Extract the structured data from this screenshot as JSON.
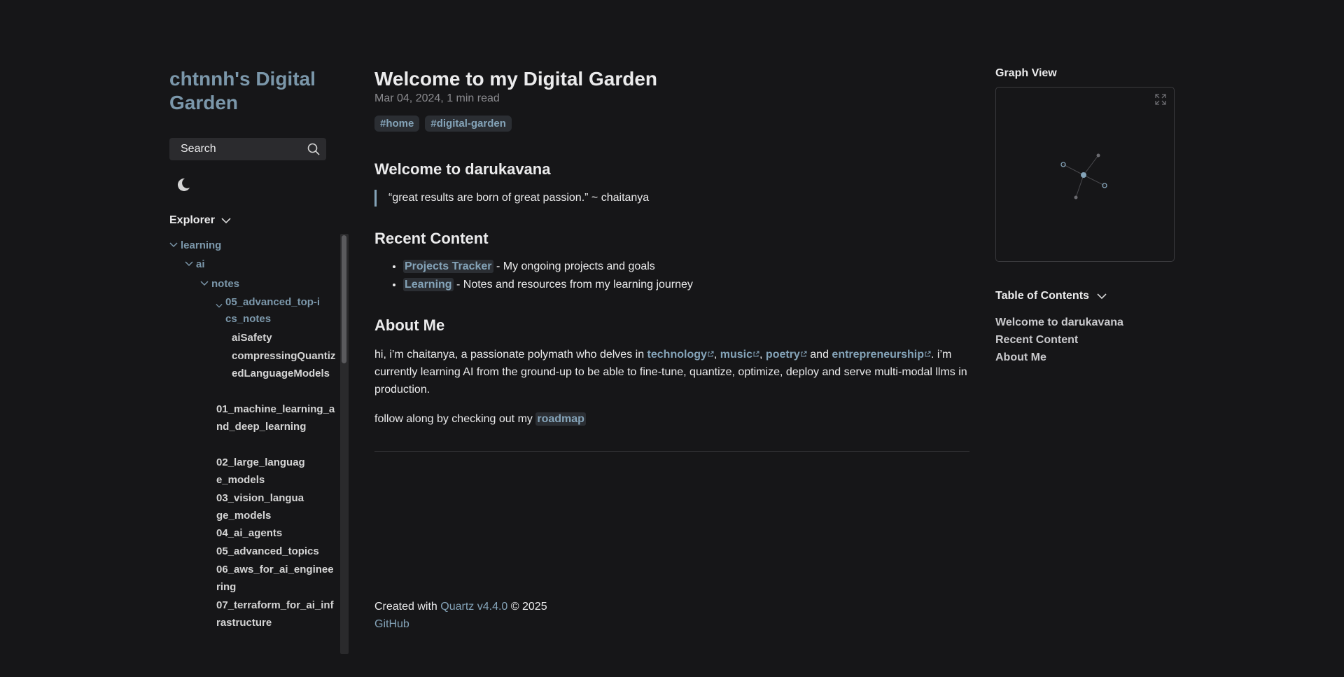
{
  "sidebar": {
    "site_title": "chtnnh's Digital Garden",
    "search_label": "Search",
    "explorer_label": "Explorer",
    "tree": [
      {
        "label": "learning",
        "type": "folder",
        "depth": 0
      },
      {
        "label": "ai",
        "type": "folder",
        "depth": 1
      },
      {
        "label": "notes",
        "type": "folder",
        "depth": 2
      },
      {
        "label": "05_advanced_top-ics_notes",
        "type": "folder",
        "depth": 3
      },
      {
        "label": "aiSafety",
        "type": "file",
        "depth": 4
      },
      {
        "label": "compressingQuantizedLanguageModels",
        "type": "file",
        "depth": 4
      },
      {
        "label": "01_machine_learning_and_deep_learning",
        "type": "file",
        "depth": 3
      },
      {
        "label": "02_large_language_models",
        "type": "file",
        "depth": 3
      },
      {
        "label": "03_vision_language_models",
        "type": "file",
        "depth": 3
      },
      {
        "label": "04_ai_agents",
        "type": "file",
        "depth": 3
      },
      {
        "label": "05_advanced_topics",
        "type": "file",
        "depth": 3
      },
      {
        "label": "06_aws_for_ai_engineering",
        "type": "file",
        "depth": 3
      },
      {
        "label": "07_terraform_for_ai_infrastructure",
        "type": "file",
        "depth": 3
      }
    ]
  },
  "main": {
    "title": "Welcome to my Digital Garden",
    "date": "Mar 04, 2024,",
    "read_time": "1 min read",
    "tags": [
      "#home",
      "#digital-garden"
    ],
    "welcome_heading": "Welcome to darukavana",
    "quote": "“great results are born of great passion.” ~ chaitanya",
    "recent_heading": "Recent Content",
    "recent": [
      {
        "link": "Projects Tracker",
        "text": " - My ongoing projects and goals"
      },
      {
        "link": "Learning",
        "text": " - Notes and resources from my learning journey"
      }
    ],
    "about_heading": "About Me",
    "about_intro": "hi, i’m chaitanya, a passionate polymath who delves in ",
    "about_links": [
      "technology",
      "music",
      "poetry",
      "entrepreneurship"
    ],
    "about_rest": ". i’m currently learning AI from the ground-up to be able to fine-tune, quantize, optimize, deploy and serve multi-modal llms in production.",
    "follow_text": "follow along by checking out my ",
    "follow_link": "roadmap",
    "footer_created": "Created with ",
    "footer_quartz": "Quartz v4.4.0",
    "footer_year": " © 2025",
    "footer_github": "GitHub"
  },
  "right": {
    "graph_title": "Graph View",
    "toc_title": "Table of Contents",
    "toc": [
      "Welcome to darukavana",
      "Recent Content",
      "About Me"
    ]
  },
  "colors": {
    "accent": "#84a3b8",
    "title": "#7b97aa",
    "background": "#161618"
  }
}
